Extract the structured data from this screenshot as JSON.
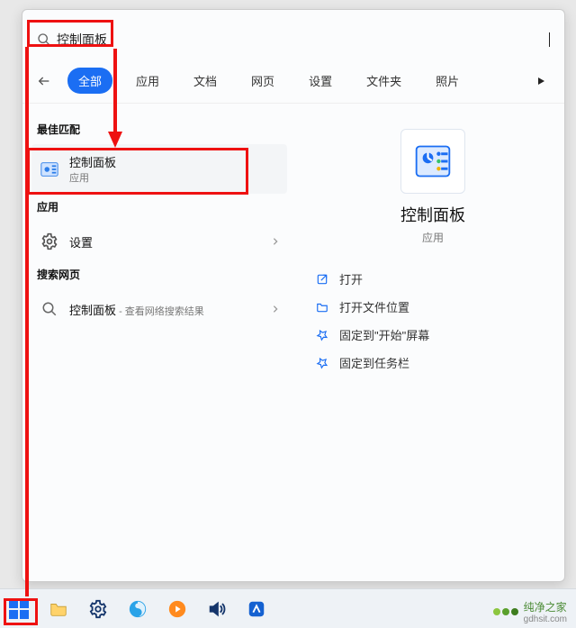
{
  "search": {
    "value": "控制面板"
  },
  "tabs": {
    "items": [
      "全部",
      "应用",
      "文档",
      "网页",
      "设置",
      "文件夹",
      "照片"
    ],
    "active_index": 0
  },
  "sections": {
    "best_label": "最佳匹配",
    "apps_label": "应用",
    "web_label": "搜索网页"
  },
  "best": {
    "title": "控制面板",
    "subtitle": "应用"
  },
  "apps": {
    "settings_label": "设置"
  },
  "web": {
    "title": "控制面板",
    "hint": " - 查看网络搜索结果"
  },
  "detail": {
    "title": "控制面板",
    "subtitle": "应用"
  },
  "actions": {
    "open": "打开",
    "open_location": "打开文件位置",
    "pin_start": "固定到\"开始\"屏幕",
    "pin_taskbar": "固定到任务栏"
  },
  "watermark": {
    "brand": "纯净之家",
    "site": "gdhsit.com"
  }
}
